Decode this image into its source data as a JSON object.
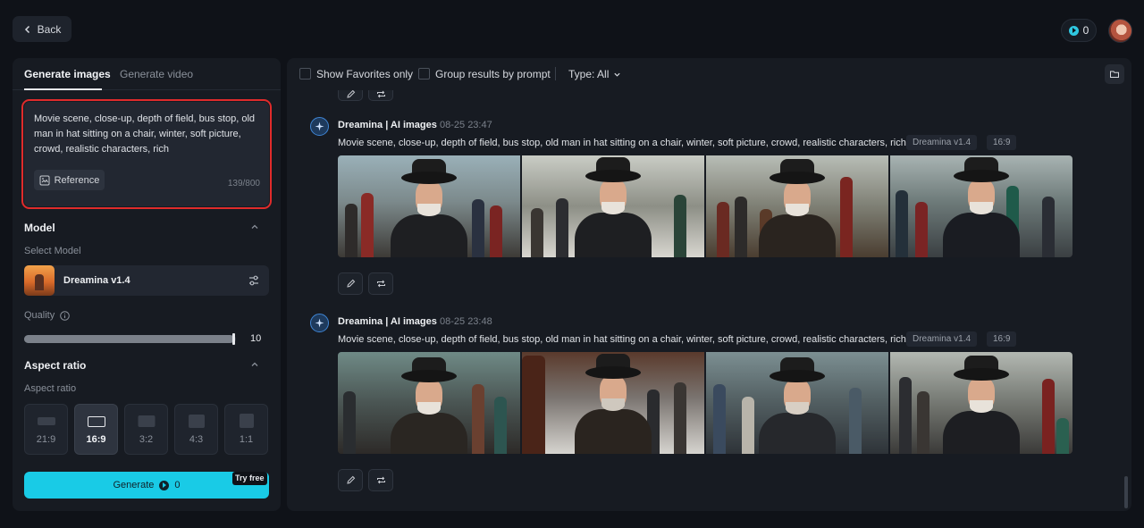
{
  "header": {
    "back_label": "Back",
    "credits": "0"
  },
  "left": {
    "tabs": [
      "Generate images",
      "Generate video"
    ],
    "prompt": "Movie scene, close-up, depth of field, bus stop, old man in hat sitting on a chair, winter, soft picture, crowd, realistic characters, rich",
    "reference_label": "Reference",
    "char_count": "139/800",
    "model_section": "Model",
    "select_model_label": "Select Model",
    "model_name": "Dreamina v1.4",
    "quality_label": "Quality",
    "quality_value": "10",
    "quality_fraction": 0.99,
    "aspect_section": "Aspect ratio",
    "aspect_label": "Aspect ratio",
    "ratios": [
      "21:9",
      "16:9",
      "3:2",
      "4:3",
      "1:1"
    ],
    "selected_ratio": "16:9",
    "generate_label": "Generate",
    "generate_cost": "0",
    "try_free": "Try free"
  },
  "right": {
    "show_favorites": "Show Favorites only",
    "group_by_prompt": "Group results by prompt",
    "type_label": "Type: All",
    "groups": [
      {
        "title": "Dreamina | AI images",
        "date": "08-25   23:47",
        "prompt": "Movie scene, close-up, depth of field, bus stop, old man in hat sitting on a chair, winter, soft picture, crowd, realistic characters, rich",
        "model_chip": "Dreamina v1.4",
        "ratio_chip": "16:9"
      },
      {
        "title": "Dreamina | AI images",
        "date": "08-25   23:48",
        "prompt": "Movie scene, close-up, depth of field, bus stop, old man in hat sitting on a chair, winter, soft picture, crowd, realistic characters, rich",
        "model_chip": "Dreamina v1.4",
        "ratio_chip": "16:9"
      }
    ]
  },
  "colors": {
    "accent": "#19cbe6",
    "highlight_border": "#e02b2b",
    "brand_badge": "#3f85d4"
  }
}
